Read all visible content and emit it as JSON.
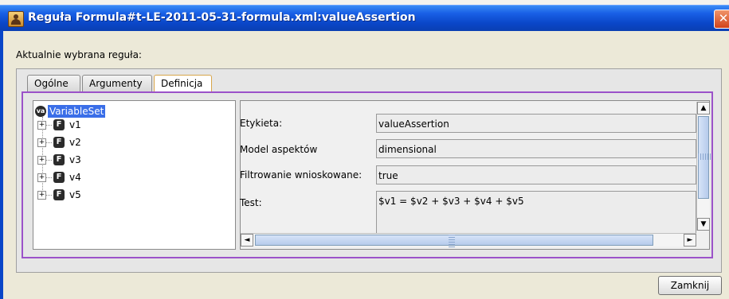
{
  "window": {
    "title": "Reguła Formula#t-LE-2011-05-31-formula.xml:valueAssertion",
    "close_glyph": "✕"
  },
  "section_label": "Aktualnie wybrana reguła:",
  "tabs": [
    {
      "label": "Ogólne",
      "active": false
    },
    {
      "label": "Argumenty",
      "active": false
    },
    {
      "label": "Definicja",
      "active": true
    }
  ],
  "tree": {
    "root": {
      "badge": "va",
      "label": "VariableSet"
    },
    "items": [
      {
        "icon": "F",
        "label": "v1"
      },
      {
        "icon": "F",
        "label": "v2"
      },
      {
        "icon": "F",
        "label": "v3"
      },
      {
        "icon": "F",
        "label": "v4"
      },
      {
        "icon": "F",
        "label": "v5"
      }
    ],
    "expander_glyph": "+"
  },
  "properties": [
    {
      "label": "Etykieta:",
      "value": "valueAssertion"
    },
    {
      "label": "Model aspektów",
      "value": "dimensional"
    },
    {
      "label": "Filtrowanie wnioskowane:",
      "value": "true"
    },
    {
      "label": "Test:",
      "value": "$v1 = $v2 + $v3 + $v4 + $v5"
    }
  ],
  "scrollbar_glyphs": {
    "up": "▲",
    "down": "▼",
    "left": "◄",
    "right": "►"
  },
  "footer": {
    "close_button": "Zamknij"
  },
  "colors": {
    "title_bar": "#0a46c8",
    "selection": "#3a6ee8",
    "frame_highlight": "#9b52c9",
    "active_tab_border": "#d7a54a"
  }
}
